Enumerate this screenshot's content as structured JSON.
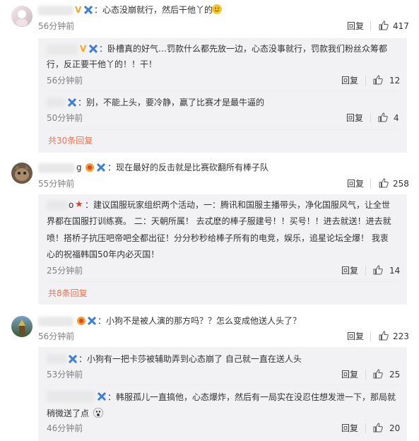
{
  "comments": [
    {
      "text": "：心态没崩就行，然后干他丫的",
      "time": "56分钟前",
      "reply": "回复",
      "likes": "417",
      "subreplies": [
        {
          "lines": [
            "：卧槽真的好气…罚款什么都先放一边，心态没事就行，罚款我们粉丝众筹都",
            "行，反正要干他丫的！！干！"
          ],
          "time": "56分钟前",
          "reply": "回复",
          "likes": "12"
        },
        {
          "lines": [
            "：别，不能上头，要冷静，赢了比赛才是最牛逼的"
          ],
          "time": "50分钟前",
          "reply": "回复",
          "likes": "4"
        }
      ],
      "more": "共30条回复"
    },
    {
      "name_tail": "g",
      "text": "：现在最好的反击就是比赛砍翻所有棒子队",
      "time": "55分钟前",
      "reply": "回复",
      "likes": "258",
      "subreplies": [
        {
          "name_tail": "o",
          "lines": [
            "：建议国服玩家组织两个活动，一：腾讯和国服主播带头，净化国服风气，让全世",
            "界都在国服打训练赛。 二：天朝所属！ 去忒麽的棒子服建号！！买号！！进去就送！进去就",
            "喷！搭桥子抗压吧帝吧全都出征！分分秒秒给棒子所有的电竞，娱乐，追星论坛全爆！ 我衷",
            "心的祝福韩国50年内必灭国！"
          ],
          "time": "25分钟前",
          "reply": "回复",
          "likes": "14"
        }
      ],
      "more": "共8条回复"
    },
    {
      "text": "：小狗不是被人演的那方吗？？怎么变成他送人头了？",
      "time": "56分钟前",
      "reply": "回复",
      "likes": "223",
      "subreplies": [
        {
          "lines": [
            "：小狗有一把卡莎被辅助弄到心态崩了 自己就一直在送人头"
          ],
          "time": "53分钟前",
          "reply": "回复",
          "likes": "25"
        },
        {
          "lines": [
            "：韩服孤儿一直搞他，心态爆炸，然后有一局实在没忍住想发泄一下，那局就",
            "稍微送了点"
          ],
          "time": "46分钟前",
          "reply": "回复",
          "likes": "20"
        }
      ]
    }
  ],
  "badges": {
    "v": "V",
    "star": "★"
  },
  "colors": {
    "accent": "#eb7350",
    "subbg": "#f2f2f5",
    "time": "#808080"
  }
}
